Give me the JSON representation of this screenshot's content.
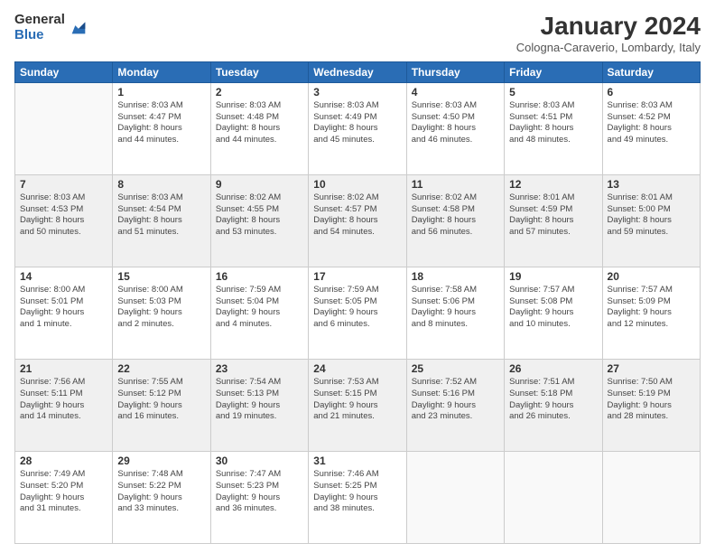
{
  "header": {
    "logo_general": "General",
    "logo_blue": "Blue",
    "title": "January 2024",
    "location": "Cologna-Caraverio, Lombardy, Italy"
  },
  "days_header": [
    "Sunday",
    "Monday",
    "Tuesday",
    "Wednesday",
    "Thursday",
    "Friday",
    "Saturday"
  ],
  "weeks": [
    [
      {
        "date": "",
        "info": ""
      },
      {
        "date": "1",
        "info": "Sunrise: 8:03 AM\nSunset: 4:47 PM\nDaylight: 8 hours\nand 44 minutes."
      },
      {
        "date": "2",
        "info": "Sunrise: 8:03 AM\nSunset: 4:48 PM\nDaylight: 8 hours\nand 44 minutes."
      },
      {
        "date": "3",
        "info": "Sunrise: 8:03 AM\nSunset: 4:49 PM\nDaylight: 8 hours\nand 45 minutes."
      },
      {
        "date": "4",
        "info": "Sunrise: 8:03 AM\nSunset: 4:50 PM\nDaylight: 8 hours\nand 46 minutes."
      },
      {
        "date": "5",
        "info": "Sunrise: 8:03 AM\nSunset: 4:51 PM\nDaylight: 8 hours\nand 48 minutes."
      },
      {
        "date": "6",
        "info": "Sunrise: 8:03 AM\nSunset: 4:52 PM\nDaylight: 8 hours\nand 49 minutes."
      }
    ],
    [
      {
        "date": "7",
        "info": "Sunrise: 8:03 AM\nSunset: 4:53 PM\nDaylight: 8 hours\nand 50 minutes."
      },
      {
        "date": "8",
        "info": "Sunrise: 8:03 AM\nSunset: 4:54 PM\nDaylight: 8 hours\nand 51 minutes."
      },
      {
        "date": "9",
        "info": "Sunrise: 8:02 AM\nSunset: 4:55 PM\nDaylight: 8 hours\nand 53 minutes."
      },
      {
        "date": "10",
        "info": "Sunrise: 8:02 AM\nSunset: 4:57 PM\nDaylight: 8 hours\nand 54 minutes."
      },
      {
        "date": "11",
        "info": "Sunrise: 8:02 AM\nSunset: 4:58 PM\nDaylight: 8 hours\nand 56 minutes."
      },
      {
        "date": "12",
        "info": "Sunrise: 8:01 AM\nSunset: 4:59 PM\nDaylight: 8 hours\nand 57 minutes."
      },
      {
        "date": "13",
        "info": "Sunrise: 8:01 AM\nSunset: 5:00 PM\nDaylight: 8 hours\nand 59 minutes."
      }
    ],
    [
      {
        "date": "14",
        "info": "Sunrise: 8:00 AM\nSunset: 5:01 PM\nDaylight: 9 hours\nand 1 minute."
      },
      {
        "date": "15",
        "info": "Sunrise: 8:00 AM\nSunset: 5:03 PM\nDaylight: 9 hours\nand 2 minutes."
      },
      {
        "date": "16",
        "info": "Sunrise: 7:59 AM\nSunset: 5:04 PM\nDaylight: 9 hours\nand 4 minutes."
      },
      {
        "date": "17",
        "info": "Sunrise: 7:59 AM\nSunset: 5:05 PM\nDaylight: 9 hours\nand 6 minutes."
      },
      {
        "date": "18",
        "info": "Sunrise: 7:58 AM\nSunset: 5:06 PM\nDaylight: 9 hours\nand 8 minutes."
      },
      {
        "date": "19",
        "info": "Sunrise: 7:57 AM\nSunset: 5:08 PM\nDaylight: 9 hours\nand 10 minutes."
      },
      {
        "date": "20",
        "info": "Sunrise: 7:57 AM\nSunset: 5:09 PM\nDaylight: 9 hours\nand 12 minutes."
      }
    ],
    [
      {
        "date": "21",
        "info": "Sunrise: 7:56 AM\nSunset: 5:11 PM\nDaylight: 9 hours\nand 14 minutes."
      },
      {
        "date": "22",
        "info": "Sunrise: 7:55 AM\nSunset: 5:12 PM\nDaylight: 9 hours\nand 16 minutes."
      },
      {
        "date": "23",
        "info": "Sunrise: 7:54 AM\nSunset: 5:13 PM\nDaylight: 9 hours\nand 19 minutes."
      },
      {
        "date": "24",
        "info": "Sunrise: 7:53 AM\nSunset: 5:15 PM\nDaylight: 9 hours\nand 21 minutes."
      },
      {
        "date": "25",
        "info": "Sunrise: 7:52 AM\nSunset: 5:16 PM\nDaylight: 9 hours\nand 23 minutes."
      },
      {
        "date": "26",
        "info": "Sunrise: 7:51 AM\nSunset: 5:18 PM\nDaylight: 9 hours\nand 26 minutes."
      },
      {
        "date": "27",
        "info": "Sunrise: 7:50 AM\nSunset: 5:19 PM\nDaylight: 9 hours\nand 28 minutes."
      }
    ],
    [
      {
        "date": "28",
        "info": "Sunrise: 7:49 AM\nSunset: 5:20 PM\nDaylight: 9 hours\nand 31 minutes."
      },
      {
        "date": "29",
        "info": "Sunrise: 7:48 AM\nSunset: 5:22 PM\nDaylight: 9 hours\nand 33 minutes."
      },
      {
        "date": "30",
        "info": "Sunrise: 7:47 AM\nSunset: 5:23 PM\nDaylight: 9 hours\nand 36 minutes."
      },
      {
        "date": "31",
        "info": "Sunrise: 7:46 AM\nSunset: 5:25 PM\nDaylight: 9 hours\nand 38 minutes."
      },
      {
        "date": "",
        "info": ""
      },
      {
        "date": "",
        "info": ""
      },
      {
        "date": "",
        "info": ""
      }
    ]
  ]
}
